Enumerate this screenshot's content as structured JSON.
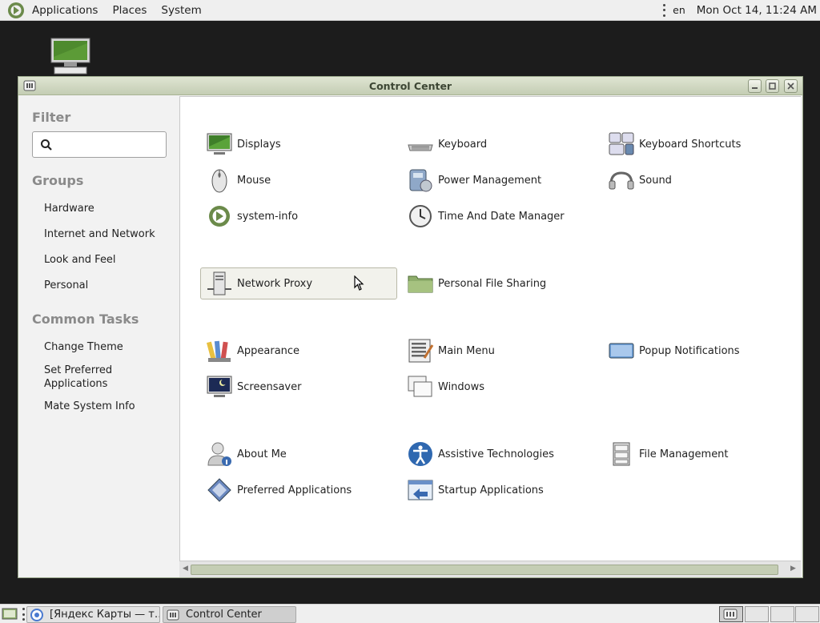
{
  "top_panel": {
    "menu": [
      "Applications",
      "Places",
      "System"
    ],
    "keyboard_layout": "en",
    "clock": "Mon Oct 14, 11:24 AM"
  },
  "window": {
    "title": "Control Center"
  },
  "sidebar": {
    "filter_heading": "Filter",
    "search_placeholder": "",
    "groups_heading": "Groups",
    "groups": [
      "Hardware",
      "Internet and Network",
      "Look and Feel",
      "Personal"
    ],
    "tasks_heading": "Common Tasks",
    "tasks": [
      "Change Theme",
      "Set Preferred Applications",
      "Mate System Info"
    ]
  },
  "items": {
    "displays": "Displays",
    "keyboard": "Keyboard",
    "keyboard_shortcuts": "Keyboard Shortcuts",
    "mouse": "Mouse",
    "power_management": "Power Management",
    "sound": "Sound",
    "system_info": "system-info",
    "time_date": "Time And Date Manager",
    "network_proxy": "Network Proxy",
    "personal_file_sharing": "Personal File Sharing",
    "appearance": "Appearance",
    "main_menu": "Main Menu",
    "popup_notifications": "Popup Notifications",
    "screensaver": "Screensaver",
    "windows": "Windows",
    "about_me": "About Me",
    "assistive_technologies": "Assistive Technologies",
    "file_management": "File Management",
    "preferred_applications": "Preferred Applications",
    "startup_applications": "Startup Applications"
  },
  "taskbar": {
    "tasks": [
      "[Яндекс Карты — т…",
      "Control Center"
    ]
  }
}
